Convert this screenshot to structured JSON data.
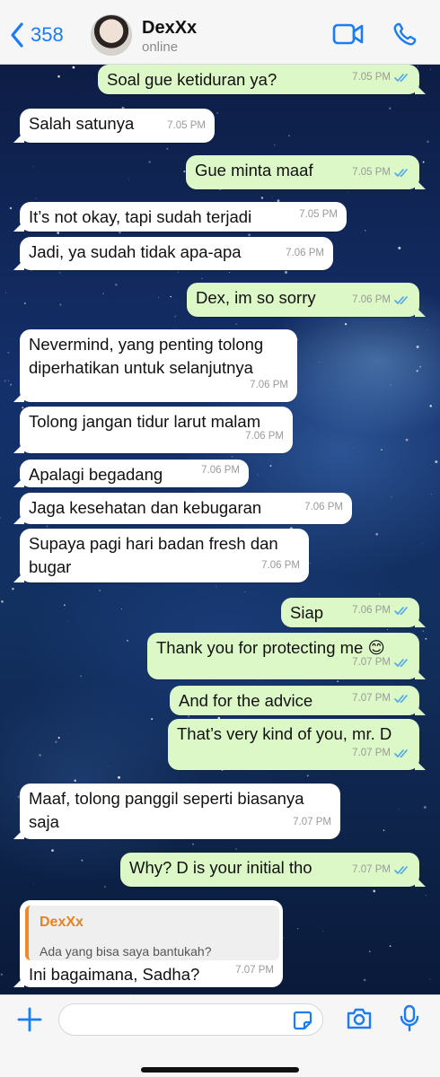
{
  "header": {
    "back_count": "358",
    "contact_name": "DexXx",
    "status": "online"
  },
  "messages": [
    {
      "dir": "out",
      "text": "Soal gue ketiduran ya?",
      "time": "7.05 PM",
      "read": true
    },
    {
      "dir": "in",
      "text": "Salah satunya",
      "time": "7.05 PM"
    },
    {
      "dir": "out",
      "text": "Gue minta maaf",
      "time": "7.05 PM",
      "read": true
    },
    {
      "dir": "in",
      "text": "It’s not okay, tapi sudah terjadi",
      "time": "7.05 PM"
    },
    {
      "dir": "in",
      "text": "Jadi, ya sudah tidak apa-apa",
      "time": "7.06 PM"
    },
    {
      "dir": "out",
      "text": "Dex, im so sorry",
      "time": "7.06 PM",
      "read": true
    },
    {
      "dir": "in",
      "text": "Nevermind, yang penting tolong\ndiperhatikan untuk selanjutnya",
      "time": "7.06 PM"
    },
    {
      "dir": "in",
      "text": "Tolong jangan tidur larut malam",
      "time": "7.06 PM"
    },
    {
      "dir": "in",
      "text": "Apalagi begadang",
      "time": "7.06 PM"
    },
    {
      "dir": "in",
      "text": "Jaga kesehatan dan kebugaran",
      "time": "7.06 PM"
    },
    {
      "dir": "in",
      "text": "Supaya pagi hari badan fresh dan\nbugar",
      "time": "7.06 PM"
    },
    {
      "dir": "out",
      "text": "Siap",
      "time": "7.06 PM",
      "read": true
    },
    {
      "dir": "out",
      "text": "Thank you for protecting me 😊",
      "time": "7.07 PM",
      "read": true
    },
    {
      "dir": "out",
      "text": "And for the advice",
      "time": "7.07 PM",
      "read": true
    },
    {
      "dir": "out",
      "text": "That’s very kind of you, mr. D",
      "time": "7.07 PM",
      "read": true
    },
    {
      "dir": "in",
      "text": "Maaf, tolong panggil seperti biasanya\nsaja",
      "time": "7.07 PM"
    },
    {
      "dir": "out",
      "text": "Why? D is your initial tho",
      "time": "7.07 PM",
      "read": true
    },
    {
      "dir": "in",
      "text": "Ini bagaimana, Sadha?",
      "time": "7.07 PM",
      "quote": {
        "name": "DexXx",
        "text": "Ada yang bisa saya bantukah?"
      }
    }
  ],
  "colors": {
    "accent": "#1b7cf5",
    "outgoing_bubble": "#dcf8c6",
    "incoming_bubble": "#ffffff",
    "read_ticks": "#4fa7e8",
    "quote_accent": "#f08a24"
  },
  "icons": {
    "back": "chevron-left-icon",
    "video": "video-camera-icon",
    "call": "phone-icon",
    "attach": "plus-icon",
    "sticker": "sticker-icon",
    "camera": "camera-icon",
    "mic": "microphone-icon"
  }
}
